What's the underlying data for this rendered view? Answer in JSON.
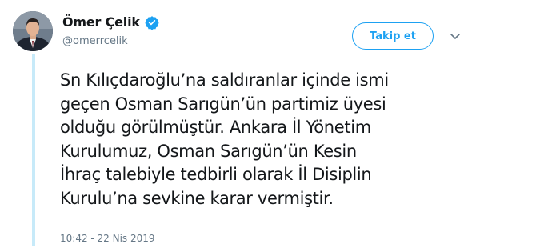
{
  "user": {
    "display_name": "Ömer Çelik",
    "handle": "@omerrcelik",
    "verified_icon": "verified-badge-icon",
    "avatar_icon": "profile-photo-avatar"
  },
  "follow_button": {
    "label": "Takip et"
  },
  "menu_icon": "chevron-down-icon",
  "tweet": {
    "lines": [
      "Sn Kılıçdaroğlu’na saldıranlar içinde ismi",
      "geçen Osman Sarıgün’ün partimiz üyesi",
      "olduğu görülmüştür. Ankara İl Yönetim",
      "Kurulumuz, Osman Sarıgün’ün Kesin",
      "İhraç talebiyle tedbirli olarak İl Disiplin",
      "Kurulu’na sevkine karar vermiştir."
    ],
    "timestamp": "10:42 - 22 Nis 2019"
  },
  "colors": {
    "accent": "#1da1f2",
    "secondary_text": "#657786",
    "primary_text": "#14171a",
    "thread_line": "#c7eaf9"
  }
}
